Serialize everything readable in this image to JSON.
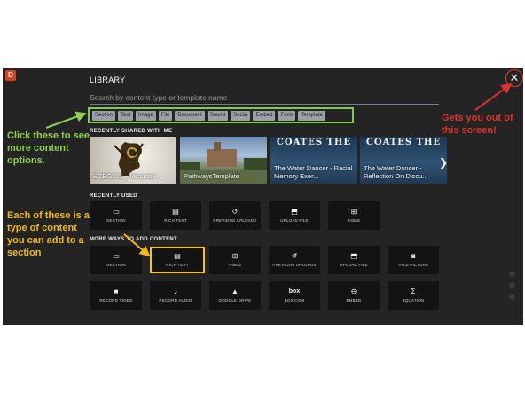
{
  "app": {
    "brand_glyph": "D",
    "library_title": "LIBRARY"
  },
  "search": {
    "placeholder": "Search by content type or template name"
  },
  "filters": [
    "Section",
    "Text",
    "Image",
    "File",
    "Document",
    "Sound",
    "Social",
    "Embed",
    "Form",
    "Template"
  ],
  "recently_shared": {
    "label": "RECENTLY SHARED WITH ME",
    "items": [
      {
        "caption": "ECEG301 _Template...",
        "banner": ""
      },
      {
        "caption": "PathwaysTemplate",
        "banner": ""
      },
      {
        "caption": "The Water Dancer - Racial Memory Exer...",
        "banner": "COATES THE"
      },
      {
        "caption": "The Water Dancer - Reflection On Discu...",
        "banner": "COATES THE"
      }
    ]
  },
  "recently_used": {
    "label": "RECENTLY USED",
    "tiles": [
      {
        "label": "SECTION",
        "icon": "section-icon",
        "glyph": "▭"
      },
      {
        "label": "RICH TEXT",
        "icon": "document-icon",
        "glyph": "▤"
      },
      {
        "label": "PREVIOUS UPLOADS",
        "icon": "history-icon",
        "glyph": "↺"
      },
      {
        "label": "UPLOAD FILE",
        "icon": "upload-icon",
        "glyph": "⬒"
      },
      {
        "label": "TABLE",
        "icon": "table-icon",
        "glyph": "⊞"
      }
    ]
  },
  "more_ways": {
    "label": "MORE WAYS TO ADD CONTENT",
    "row1": [
      {
        "label": "SECTION",
        "icon": "section-icon",
        "glyph": "▭"
      },
      {
        "label": "RICH TEXT",
        "icon": "document-icon",
        "glyph": "▤"
      },
      {
        "label": "TABLE",
        "icon": "table-icon",
        "glyph": "⊞"
      },
      {
        "label": "PREVIOUS UPLOADS",
        "icon": "history-icon",
        "glyph": "↺"
      },
      {
        "label": "UPLOAD FILE",
        "icon": "upload-icon",
        "glyph": "⬒"
      },
      {
        "label": "TAKE PICTURE",
        "icon": "camera-icon",
        "glyph": "◙"
      }
    ],
    "row2": [
      {
        "label": "RECORD VIDEO",
        "icon": "video-icon",
        "glyph": "■"
      },
      {
        "label": "RECORD AUDIO",
        "icon": "microphone-icon",
        "glyph": "♪"
      },
      {
        "label": "GOOGLE DRIVE",
        "icon": "google-drive-icon",
        "glyph": "▲"
      },
      {
        "label": "BOX.COM",
        "icon": "box-icon",
        "glyph": "box"
      },
      {
        "label": "EMBED",
        "icon": "link-icon",
        "glyph": "⊖"
      },
      {
        "label": "EQUATION",
        "icon": "sigma-icon",
        "glyph": "Σ"
      }
    ]
  },
  "annotations": {
    "click_these": "Click these to see more content options.",
    "each_tile": "Each of these is a type of content you can add to a section",
    "gets_out": "Gets you out of this screen!"
  },
  "colors": {
    "annotation_green": "#8fd14f",
    "annotation_orange": "#f2b81c",
    "annotation_red": "#e0322b",
    "panel_bg": "#242424"
  }
}
